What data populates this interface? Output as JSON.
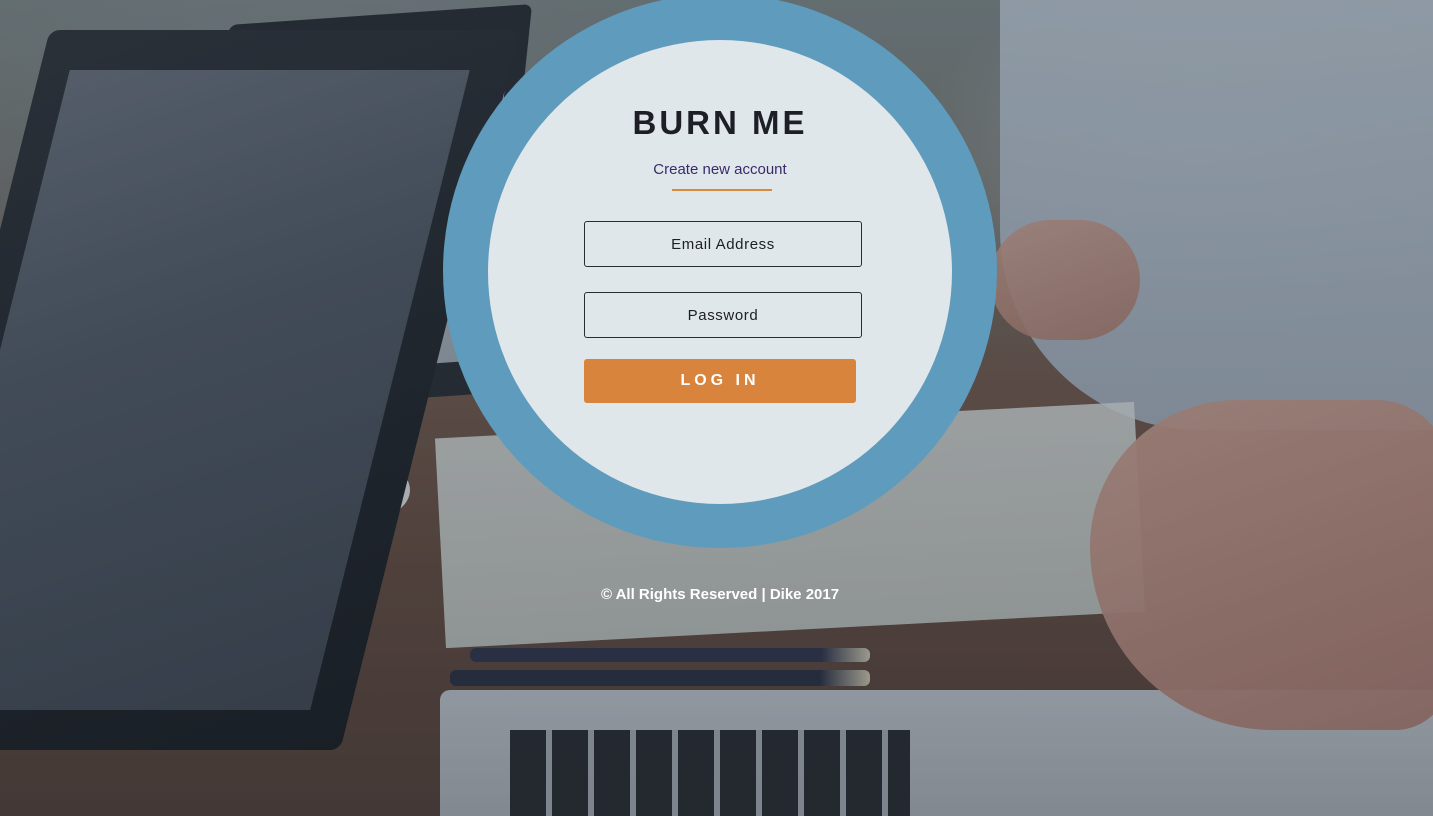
{
  "brand": {
    "title": "BURN ME"
  },
  "links": {
    "create_account": "Create new account"
  },
  "form": {
    "email_placeholder": "Email Address",
    "password_placeholder": "Password",
    "email_value": "",
    "password_value": "",
    "login_label": "LOG IN"
  },
  "footer": {
    "text": "© All Rights Reserved | Dike 2017"
  },
  "colors": {
    "ring": "#5f9bbc",
    "accent": "#d9843c",
    "link": "#3a2a6a",
    "title": "#1e1f26"
  }
}
